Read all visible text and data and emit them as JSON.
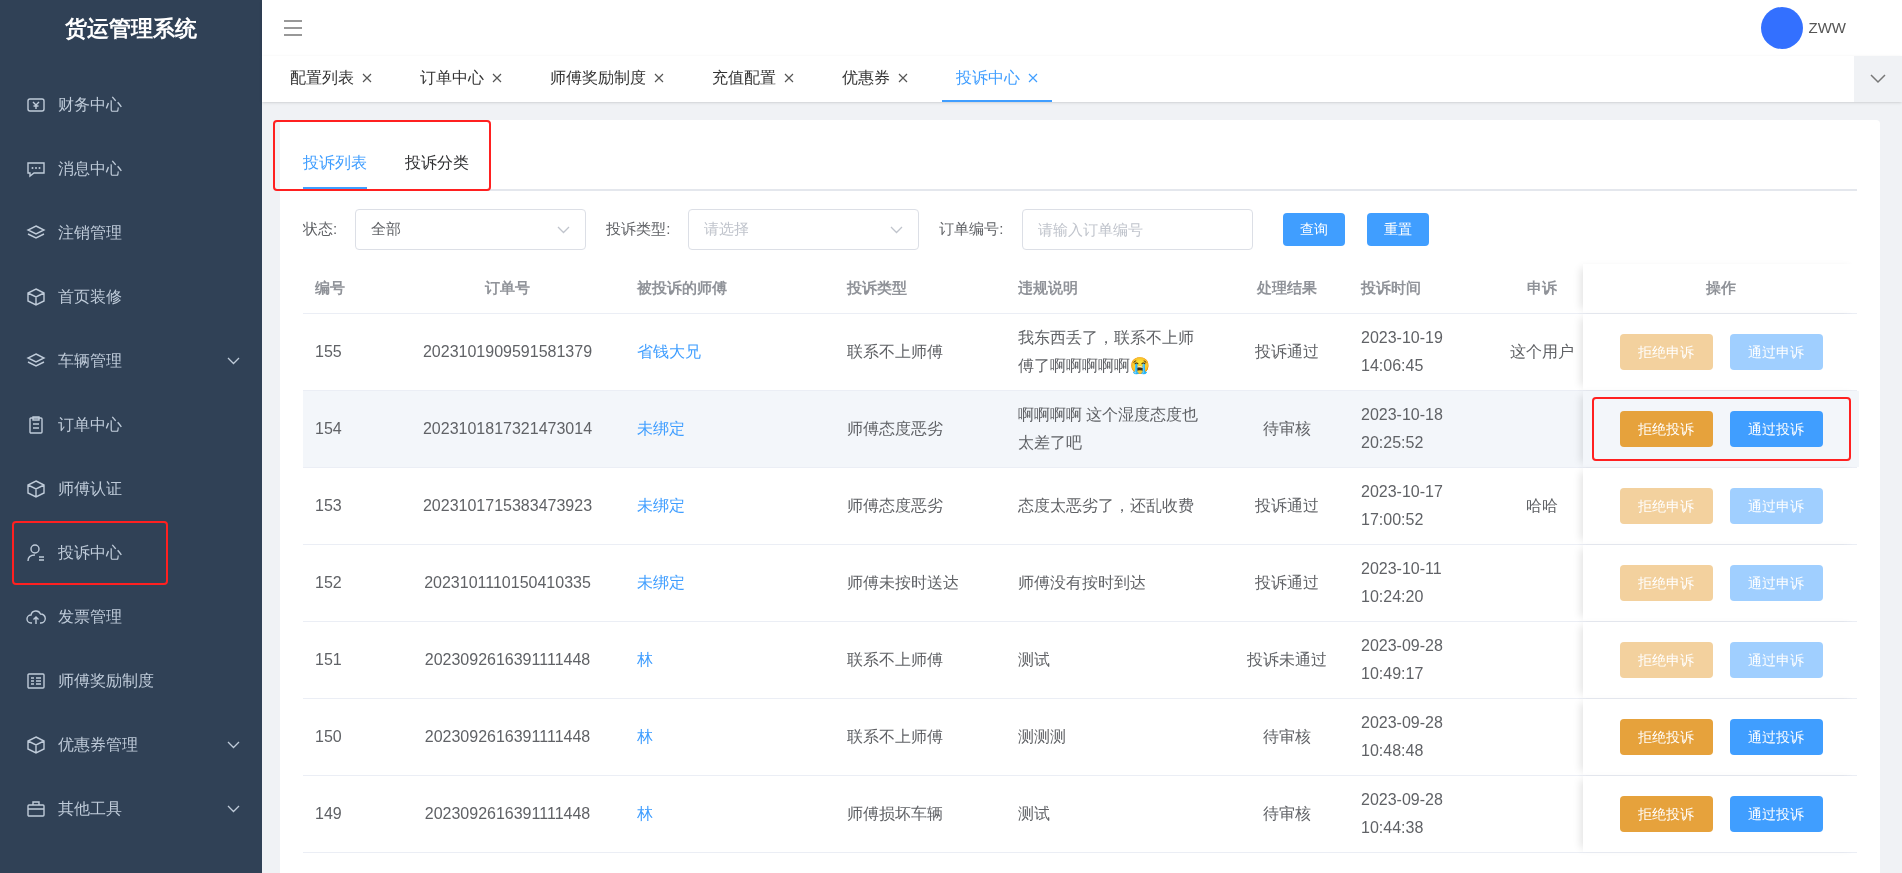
{
  "sidebar": {
    "title": "货运管理系统",
    "items": [
      {
        "label": "财务中心",
        "expandable": false,
        "annotated": false
      },
      {
        "label": "消息中心",
        "expandable": false,
        "annotated": false
      },
      {
        "label": "注销管理",
        "expandable": false,
        "annotated": false
      },
      {
        "label": "首页装修",
        "expandable": false,
        "annotated": false
      },
      {
        "label": "车辆管理",
        "expandable": true,
        "annotated": false
      },
      {
        "label": "订单中心",
        "expandable": false,
        "annotated": false
      },
      {
        "label": "师傅认证",
        "expandable": false,
        "annotated": false
      },
      {
        "label": "投诉中心",
        "expandable": false,
        "annotated": true
      },
      {
        "label": "发票管理",
        "expandable": false,
        "annotated": false
      },
      {
        "label": "师傅奖励制度",
        "expandable": false,
        "annotated": false
      },
      {
        "label": "优惠券管理",
        "expandable": true,
        "annotated": false
      },
      {
        "label": "其他工具",
        "expandable": true,
        "annotated": false
      }
    ]
  },
  "header": {
    "user": "ZWW"
  },
  "open_tabs": [
    {
      "label": "配置列表",
      "selected": false
    },
    {
      "label": "订单中心",
      "selected": false
    },
    {
      "label": "师傅奖励制度",
      "selected": false
    },
    {
      "label": "充值配置",
      "selected": false
    },
    {
      "label": "优惠券",
      "selected": false
    },
    {
      "label": "投诉中心",
      "selected": true
    }
  ],
  "sub_tabs": {
    "annotated": true,
    "items": [
      {
        "label": "投诉列表",
        "selected": true
      },
      {
        "label": "投诉分类",
        "selected": false
      }
    ]
  },
  "filters": [
    {
      "kind": "select",
      "label": "状态:",
      "value": "全部"
    },
    {
      "kind": "select",
      "label": "投诉类型:",
      "placeholder": "请选择"
    },
    {
      "kind": "input",
      "label": "订单编号:",
      "placeholder": "请输入订单编号"
    }
  ],
  "filter_buttons": [
    "查询",
    "重置"
  ],
  "table": {
    "columns": [
      "编号",
      "订单号",
      "被投诉的师傅",
      "投诉类型",
      "违规说明",
      "处理结果",
      "投诉时间",
      "申诉",
      "操作"
    ],
    "rows": [
      {
        "id": "155",
        "order": "2023101909591581379",
        "driver": "省钱大兄",
        "type": "联系不上师傅",
        "description": "我东西丢了，联系不上师傅了啊啊啊啊啊😭",
        "result": "投诉通过",
        "time": "2023-10-19 14:06:45",
        "appeal": "这个用户",
        "highlighted": false,
        "annotated": false,
        "actions": [
          {
            "kind": "reject",
            "label": "拒绝申诉",
            "disabled": true
          },
          {
            "kind": "approve",
            "label": "通过申诉",
            "disabled": true
          }
        ]
      },
      {
        "id": "154",
        "order": "2023101817321473014",
        "driver": "未绑定",
        "type": "师傅态度恶劣",
        "description": "啊啊啊啊 这个湿度态度也太差了吧",
        "result": "待审核",
        "time": "2023-10-18 20:25:52",
        "highlighted": true,
        "annotated": true,
        "actions": [
          {
            "kind": "reject",
            "label": "拒绝投诉",
            "disabled": false
          },
          {
            "kind": "approve",
            "label": "通过投诉",
            "disabled": false
          }
        ]
      },
      {
        "id": "153",
        "order": "2023101715383473923",
        "driver": "未绑定",
        "type": "师傅态度恶劣",
        "description": "态度太恶劣了，还乱收费",
        "result": "投诉通过",
        "time": "2023-10-17 17:00:52",
        "appeal": "哈哈",
        "highlighted": false,
        "annotated": false,
        "actions": [
          {
            "kind": "reject",
            "label": "拒绝申诉",
            "disabled": true
          },
          {
            "kind": "approve",
            "label": "通过申诉",
            "disabled": true
          }
        ]
      },
      {
        "id": "152",
        "order": "2023101110150410335",
        "driver": "未绑定",
        "type": "师傅未按时送达",
        "description": "师傅没有按时到达",
        "result": "投诉通过",
        "time": "2023-10-11 10:24:20",
        "highlighted": false,
        "annotated": false,
        "actions": [
          {
            "kind": "reject",
            "label": "拒绝申诉",
            "disabled": true
          },
          {
            "kind": "approve",
            "label": "通过申诉",
            "disabled": true
          }
        ]
      },
      {
        "id": "151",
        "order": "2023092616391111448",
        "driver": "林",
        "type": "联系不上师傅",
        "description": "测试",
        "result": "投诉未通过",
        "time": "2023-09-28 10:49:17",
        "highlighted": false,
        "annotated": false,
        "actions": [
          {
            "kind": "reject",
            "label": "拒绝申诉",
            "disabled": true
          },
          {
            "kind": "approve",
            "label": "通过申诉",
            "disabled": true
          }
        ]
      },
      {
        "id": "150",
        "order": "2023092616391111448",
        "driver": "林",
        "type": "联系不上师傅",
        "description": "测测测",
        "result": "待审核",
        "time": "2023-09-28 10:48:48",
        "highlighted": false,
        "annotated": false,
        "actions": [
          {
            "kind": "reject",
            "label": "拒绝投诉",
            "disabled": false
          },
          {
            "kind": "approve",
            "label": "通过投诉",
            "disabled": false
          }
        ]
      },
      {
        "id": "149",
        "order": "2023092616391111448",
        "driver": "林",
        "type": "师傅损坏车辆",
        "description": "测试",
        "result": "待审核",
        "time": "2023-09-28 10:44:38",
        "highlighted": false,
        "annotated": false,
        "actions": [
          {
            "kind": "reject",
            "label": "拒绝投诉",
            "disabled": false
          },
          {
            "kind": "approve",
            "label": "通过投诉",
            "disabled": false
          }
        ]
      }
    ]
  }
}
